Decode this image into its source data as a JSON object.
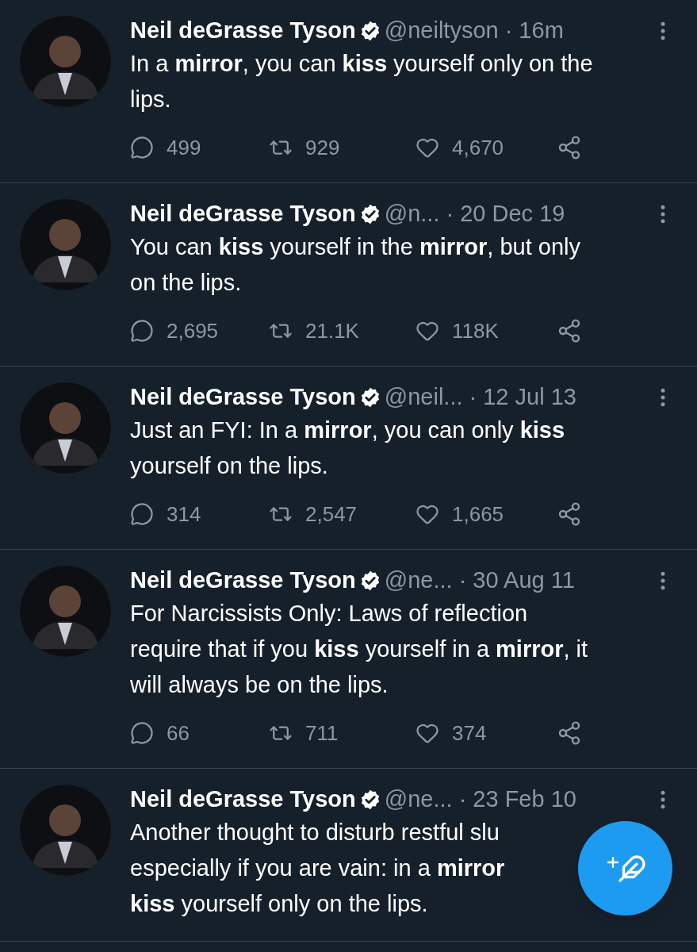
{
  "tweets": [
    {
      "name": "Neil deGrasse Tyson",
      "verified": true,
      "handle": "@neiltyson",
      "time": "· 16m",
      "lines": [
        "In a **mirror**, you can **kiss** yourself only on the",
        "lips."
      ],
      "actions": {
        "replies": "499",
        "retweets": "929",
        "likes": "4,670"
      }
    },
    {
      "name": "Neil deGrasse Tyson",
      "verified": true,
      "handle": "@n...",
      "time": "· 20 Dec 19",
      "lines": [
        "You can **kiss** yourself in the **mirror**, but only",
        "on the lips."
      ],
      "actions": {
        "replies": "2,695",
        "retweets": "21.1K",
        "likes": "118K"
      }
    },
    {
      "name": "Neil deGrasse Tyson",
      "verified": true,
      "handle": "@neil...",
      "time": "· 12 Jul 13",
      "lines": [
        "Just an FYI:  In a **mirror**, you can only **kiss**",
        "yourself on the lips."
      ],
      "actions": {
        "replies": "314",
        "retweets": "2,547",
        "likes": "1,665"
      }
    },
    {
      "name": "Neil deGrasse Tyson",
      "verified": true,
      "handle": "@ne...",
      "time": "· 30 Aug 11",
      "lines": [
        "For Narcissists Only: Laws of reflection",
        "require that if you **kiss** yourself in a **mirror**, it",
        "will always be on the lips."
      ],
      "actions": {
        "replies": "66",
        "retweets": "711",
        "likes": "374"
      }
    },
    {
      "name": "Neil deGrasse Tyson",
      "verified": true,
      "handle": "@ne...",
      "time": "· 23 Feb 10",
      "lines": [
        "Another thought to disturb restful slu",
        "especially if you are vain: in a **mirror**",
        "**kiss** yourself only on the lips."
      ]
    }
  ]
}
